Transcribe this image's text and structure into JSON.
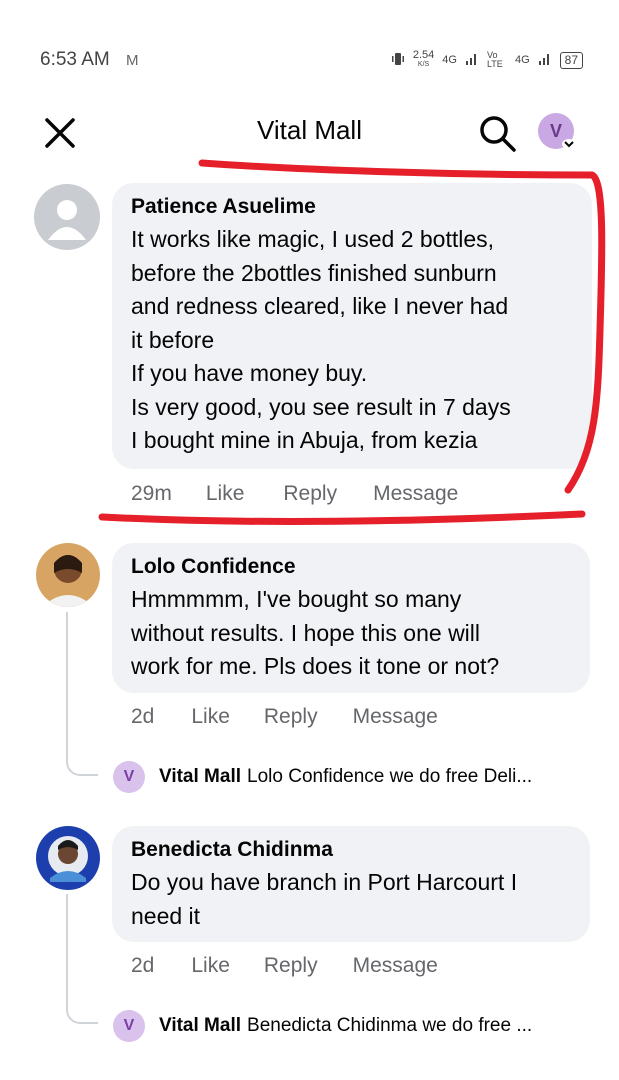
{
  "status_bar": {
    "time": "6:53 AM",
    "mail_icon": "M",
    "speed": "2.54",
    "speed_unit": "K/S",
    "network1": "4G",
    "volte": "Vo LTE",
    "network2": "4G",
    "battery": "87"
  },
  "header": {
    "title": "Vital Mall",
    "profile_initial": "V"
  },
  "comments": [
    {
      "author": "Patience Asuelime",
      "text": "It works like magic, I used 2 bottles,\nbefore the 2bottles finished sunburn\nand redness cleared, like I never had\nit before\nIf you have money buy.\nIs very good, you see result in 7 days\nI bought mine in Abuja, from kezia",
      "time": "29m",
      "like": "Like",
      "reply": "Reply",
      "message": "Message"
    },
    {
      "author": "Lolo Confidence",
      "text": "Hmmmmm, I've bought so many\nwithout results. I hope this one will\nwork for me. Pls does it tone or not?",
      "time": "2d",
      "like": "Like",
      "reply": "Reply",
      "message": "Message",
      "reply_preview": {
        "initial": "V",
        "name": "Vital Mall",
        "text": "Lolo Confidence  we do free Deli..."
      }
    },
    {
      "author": "Benedicta Chidinma",
      "text": "Do you have branch in Port Harcourt I\nneed it",
      "time": "2d",
      "like": "Like",
      "reply": "Reply",
      "message": "Message",
      "reply_preview": {
        "initial": "V",
        "name": "Vital Mall",
        "text": "Benedicta Chidinma we do free ..."
      }
    }
  ],
  "colors": {
    "annotation": "#e5202a",
    "bubble": "#f0f2f5",
    "meta": "#65676b"
  }
}
